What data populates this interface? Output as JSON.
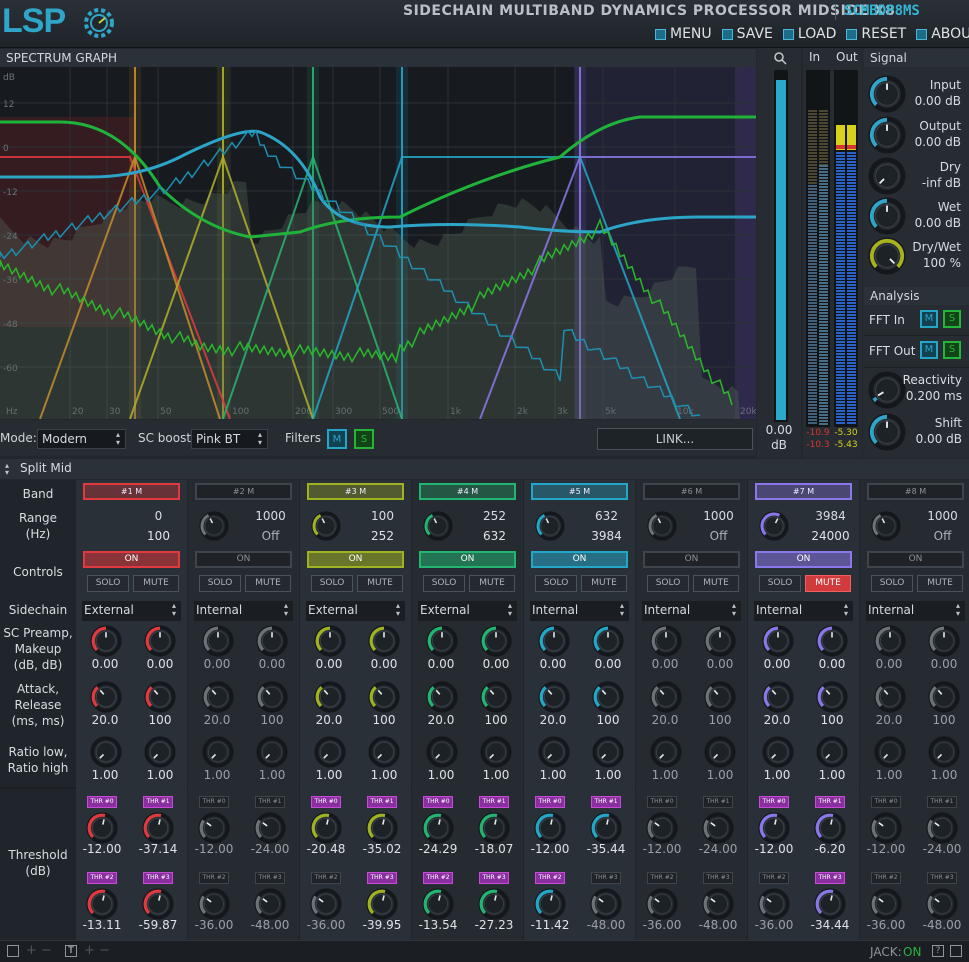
{
  "header": {
    "logo": "LSP",
    "title": "SIDECHAIN MULTIBAND DYNAMICS PROCESSOR MIDSIDE X8",
    "code": "SCMBDP8MS",
    "menu": [
      {
        "label": "MENU",
        "icon": "menu-icon"
      },
      {
        "label": "SAVE",
        "icon": "save-icon"
      },
      {
        "label": "LOAD",
        "icon": "load-icon"
      },
      {
        "label": "RESET",
        "icon": "reset-icon"
      },
      {
        "label": "ABOUT",
        "icon": "about-icon"
      }
    ]
  },
  "spectrum": {
    "header": "SPECTRUM GRAPH",
    "ylabels": [
      "dB",
      "12",
      "0",
      "-12",
      "-24",
      "-36",
      "-48",
      "-60"
    ],
    "xlabels": [
      "Hz",
      "20",
      "30",
      "50",
      "100",
      "200",
      "300",
      "500",
      "1k",
      "2k",
      "3k",
      "5k",
      "10k",
      "20k"
    ],
    "mode_label": "Mode:",
    "mode_value": "Modern",
    "scboost_label": "SC boost:",
    "scboost_value": "Pink BT",
    "filters_label": "Filters",
    "m": "M",
    "s": "S",
    "link_label": "LINK..."
  },
  "meters": {
    "zoom_value": "0.00",
    "zoom_unit": "dB",
    "in_label": "In",
    "out_label": "Out",
    "in_vals": [
      "-10.9",
      "-10.3"
    ],
    "out_vals": [
      "-5.30",
      "-5.43"
    ]
  },
  "signal": {
    "header": "Signal",
    "knobs": [
      {
        "label": "Input",
        "value": "0.00 dB",
        "color": "#2fa6c9",
        "level": 0.5
      },
      {
        "label": "Output",
        "value": "0.00 dB",
        "color": "#2fa6c9",
        "level": 0.5
      },
      {
        "label": "Dry",
        "value": "-inf dB",
        "color": "#9a9a1e",
        "level": 0.0
      },
      {
        "label": "Wet",
        "value": "0.00 dB",
        "color": "#2fa6c9",
        "level": 0.5
      },
      {
        "label": "Dry/Wet",
        "value": "100 %",
        "color": "#a7b21c",
        "level": 1.0
      }
    ],
    "analysis_header": "Analysis",
    "fft_in": "FFT In",
    "fft_out": "FFT Out",
    "m": "M",
    "s": "S",
    "reactivity_label": "Reactivity",
    "reactivity_value": "0.200 ms",
    "shift_label": "Shift",
    "shift_value": "0.00 dB"
  },
  "split": {
    "label": "Split Mid"
  },
  "rows": {
    "band": "Band",
    "range": "Range\n(Hz)",
    "controls": "Controls",
    "sidechain": "Sidechain",
    "preamp": "SC Preamp,\nMakeup\n(dB, dB)",
    "attack": "Attack,\nRelease\n(ms, ms)",
    "ratio": "Ratio low,\nRatio high",
    "threshold": "Threshold\n(dB)"
  },
  "on_label": "ON",
  "solo_label": "SOLO",
  "mute_label": "MUTE",
  "bands": [
    {
      "name": "#1 M",
      "color": "#e0393e",
      "active": true,
      "range": [
        "0",
        "100"
      ],
      "sidechain": "External",
      "preamp": [
        "0.00",
        "0.00"
      ],
      "attack": [
        "20.0",
        "100"
      ],
      "ratio": [
        "1.00",
        "1.00"
      ],
      "thr": [
        "THR #0",
        "THR #1",
        "THR #2",
        "THR #3"
      ],
      "thr_vals": [
        "-12.00",
        "-37.14",
        "-13.11",
        "-59.87"
      ],
      "thr_active": [
        true,
        true,
        true,
        true
      ],
      "mute": false
    },
    {
      "name": "#2 M",
      "color": "#857060",
      "active": false,
      "range": [
        "1000",
        "Off"
      ],
      "sidechain": "Internal",
      "preamp": [
        "0.00",
        "0.00"
      ],
      "attack": [
        "20.0",
        "100"
      ],
      "ratio": [
        "1.00",
        "1.00"
      ],
      "thr": [
        "THR #0",
        "THR #1",
        "THR #2",
        "THR #3"
      ],
      "thr_vals": [
        "-12.00",
        "-24.00",
        "-36.00",
        "-48.00"
      ],
      "thr_active": [
        false,
        false,
        false,
        false
      ],
      "mute": false
    },
    {
      "name": "#3 M",
      "color": "#9fb221",
      "active": true,
      "range": [
        "100",
        "252"
      ],
      "sidechain": "External",
      "preamp": [
        "0.00",
        "0.00"
      ],
      "attack": [
        "20.0",
        "100"
      ],
      "ratio": [
        "1.00",
        "1.00"
      ],
      "thr": [
        "THR #0",
        "THR #1",
        "THR #2",
        "THR #3"
      ],
      "thr_vals": [
        "-20.48",
        "-35.02",
        "-36.00",
        "-39.95"
      ],
      "thr_active": [
        true,
        true,
        false,
        true
      ],
      "mute": false
    },
    {
      "name": "#4 M",
      "color": "#22b470",
      "active": true,
      "range": [
        "252",
        "632"
      ],
      "sidechain": "External",
      "preamp": [
        "0.00",
        "0.00"
      ],
      "attack": [
        "20.0",
        "100"
      ],
      "ratio": [
        "1.00",
        "1.00"
      ],
      "thr": [
        "THR #0",
        "THR #1",
        "THR #2",
        "THR #3"
      ],
      "thr_vals": [
        "-24.29",
        "-18.07",
        "-13.54",
        "-27.23"
      ],
      "thr_active": [
        true,
        true,
        true,
        true
      ],
      "mute": false
    },
    {
      "name": "#5 M",
      "color": "#23a6c8",
      "active": true,
      "range": [
        "632",
        "3984"
      ],
      "sidechain": "Internal",
      "preamp": [
        "0.00",
        "0.00"
      ],
      "attack": [
        "20.0",
        "100"
      ],
      "ratio": [
        "1.00",
        "1.00"
      ],
      "thr": [
        "THR #0",
        "THR #1",
        "THR #2",
        "THR #3"
      ],
      "thr_vals": [
        "-12.00",
        "-35.44",
        "-11.42",
        "-48.00"
      ],
      "thr_active": [
        true,
        true,
        true,
        false
      ],
      "mute": false
    },
    {
      "name": "#6 M",
      "color": "#6c7278",
      "active": false,
      "range": [
        "1000",
        "Off"
      ],
      "sidechain": "Internal",
      "preamp": [
        "0.00",
        "0.00"
      ],
      "attack": [
        "20.0",
        "100"
      ],
      "ratio": [
        "1.00",
        "1.00"
      ],
      "thr": [
        "THR #0",
        "THR #1",
        "THR #2",
        "THR #3"
      ],
      "thr_vals": [
        "-12.00",
        "-24.00",
        "-36.00",
        "-48.00"
      ],
      "thr_active": [
        false,
        false,
        false,
        false
      ],
      "mute": false
    },
    {
      "name": "#7 M",
      "color": "#8a78ea",
      "active": true,
      "range": [
        "3984",
        "24000"
      ],
      "sidechain": "Internal",
      "preamp": [
        "0.00",
        "0.00"
      ],
      "attack": [
        "20.0",
        "100"
      ],
      "ratio": [
        "1.00",
        "1.00"
      ],
      "thr": [
        "THR #0",
        "THR #1",
        "THR #2",
        "THR #3"
      ],
      "thr_vals": [
        "-12.00",
        "-6.20",
        "-36.00",
        "-34.44"
      ],
      "thr_active": [
        true,
        true,
        false,
        true
      ],
      "mute": true
    },
    {
      "name": "#8 M",
      "color": "#8a6a72",
      "active": false,
      "range": [
        "1000",
        "Off"
      ],
      "sidechain": "Internal",
      "preamp": [
        "0.00",
        "0.00"
      ],
      "attack": [
        "20.0",
        "100"
      ],
      "ratio": [
        "1.00",
        "1.00"
      ],
      "thr": [
        "THR #0",
        "THR #1",
        "THR #2",
        "THR #3"
      ],
      "thr_vals": [
        "-12.00",
        "-24.00",
        "-36.00",
        "-48.00"
      ],
      "thr_active": [
        false,
        false,
        false,
        false
      ],
      "mute": false
    }
  ],
  "footer": {
    "jack_label": "JACK:",
    "jack_value": "ON"
  }
}
